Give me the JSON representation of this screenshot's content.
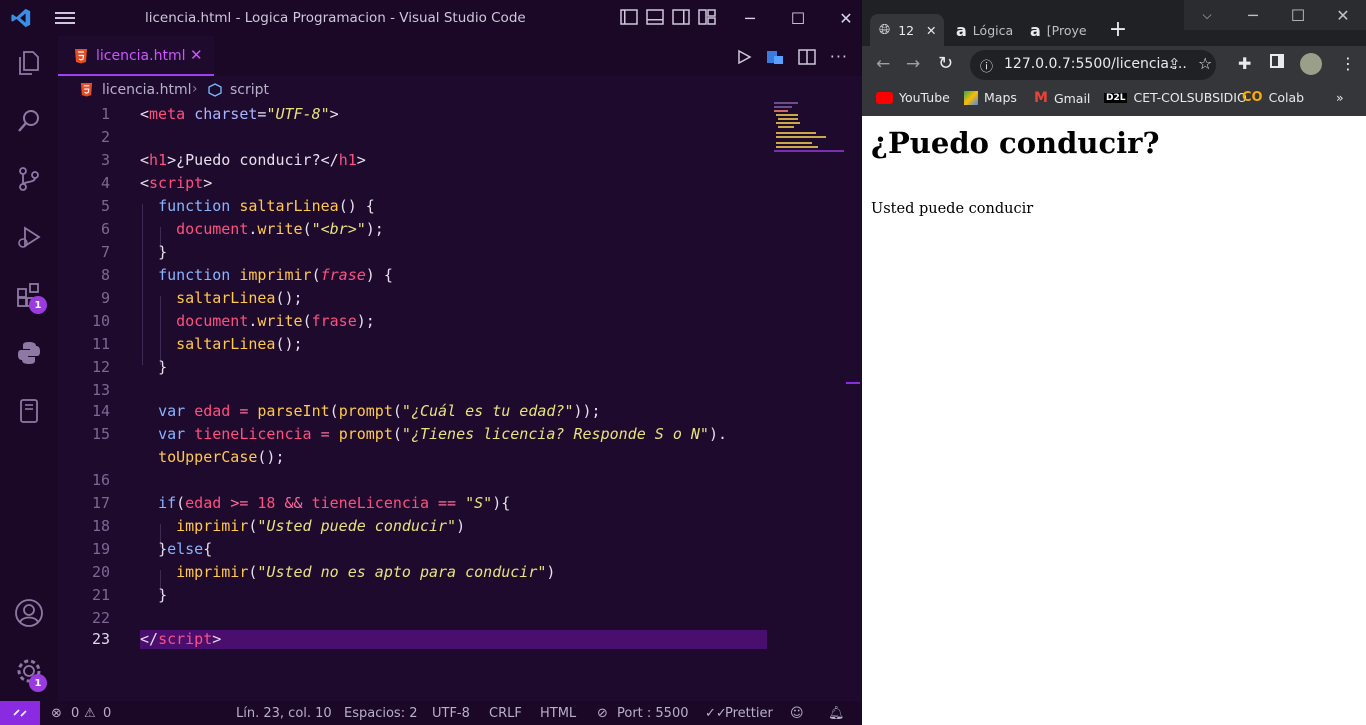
{
  "window": {
    "title": "licencia.html - Logica Programacion - Visual Studio Code"
  },
  "activity": {
    "extensions_badge": "1",
    "accounts_badge": "1"
  },
  "tab": {
    "label": "licencia.html",
    "close": "✕"
  },
  "breadcrumb": {
    "file": "licencia.html",
    "symbol": "script"
  },
  "code": {
    "lines": [
      "1",
      "2",
      "3",
      "4",
      "5",
      "6",
      "7",
      "8",
      "9",
      "10",
      "11",
      "12",
      "13",
      "14",
      "15",
      "",
      "16",
      "17",
      "18",
      "19",
      "20",
      "21",
      "22",
      "23"
    ]
  },
  "status": {
    "errors": "0",
    "warnings": "0",
    "position": "Lín. 23, col. 10",
    "spaces": "Espacios: 2",
    "encoding": "UTF-8",
    "eol": "CRLF",
    "language": "HTML",
    "port": "Port : 5500",
    "formatter": "Prettier"
  },
  "browser": {
    "tabs": [
      "12",
      "Lógica",
      "[Proye"
    ],
    "address": "127.0.0.7:5500/licencia....",
    "bookmarks": [
      "YouTube",
      "Maps",
      "Gmail",
      "CET-COLSUBSIDIO",
      "Colab"
    ],
    "page_heading": "¿Puedo conducir?",
    "page_text": "Usted puede conducir"
  }
}
